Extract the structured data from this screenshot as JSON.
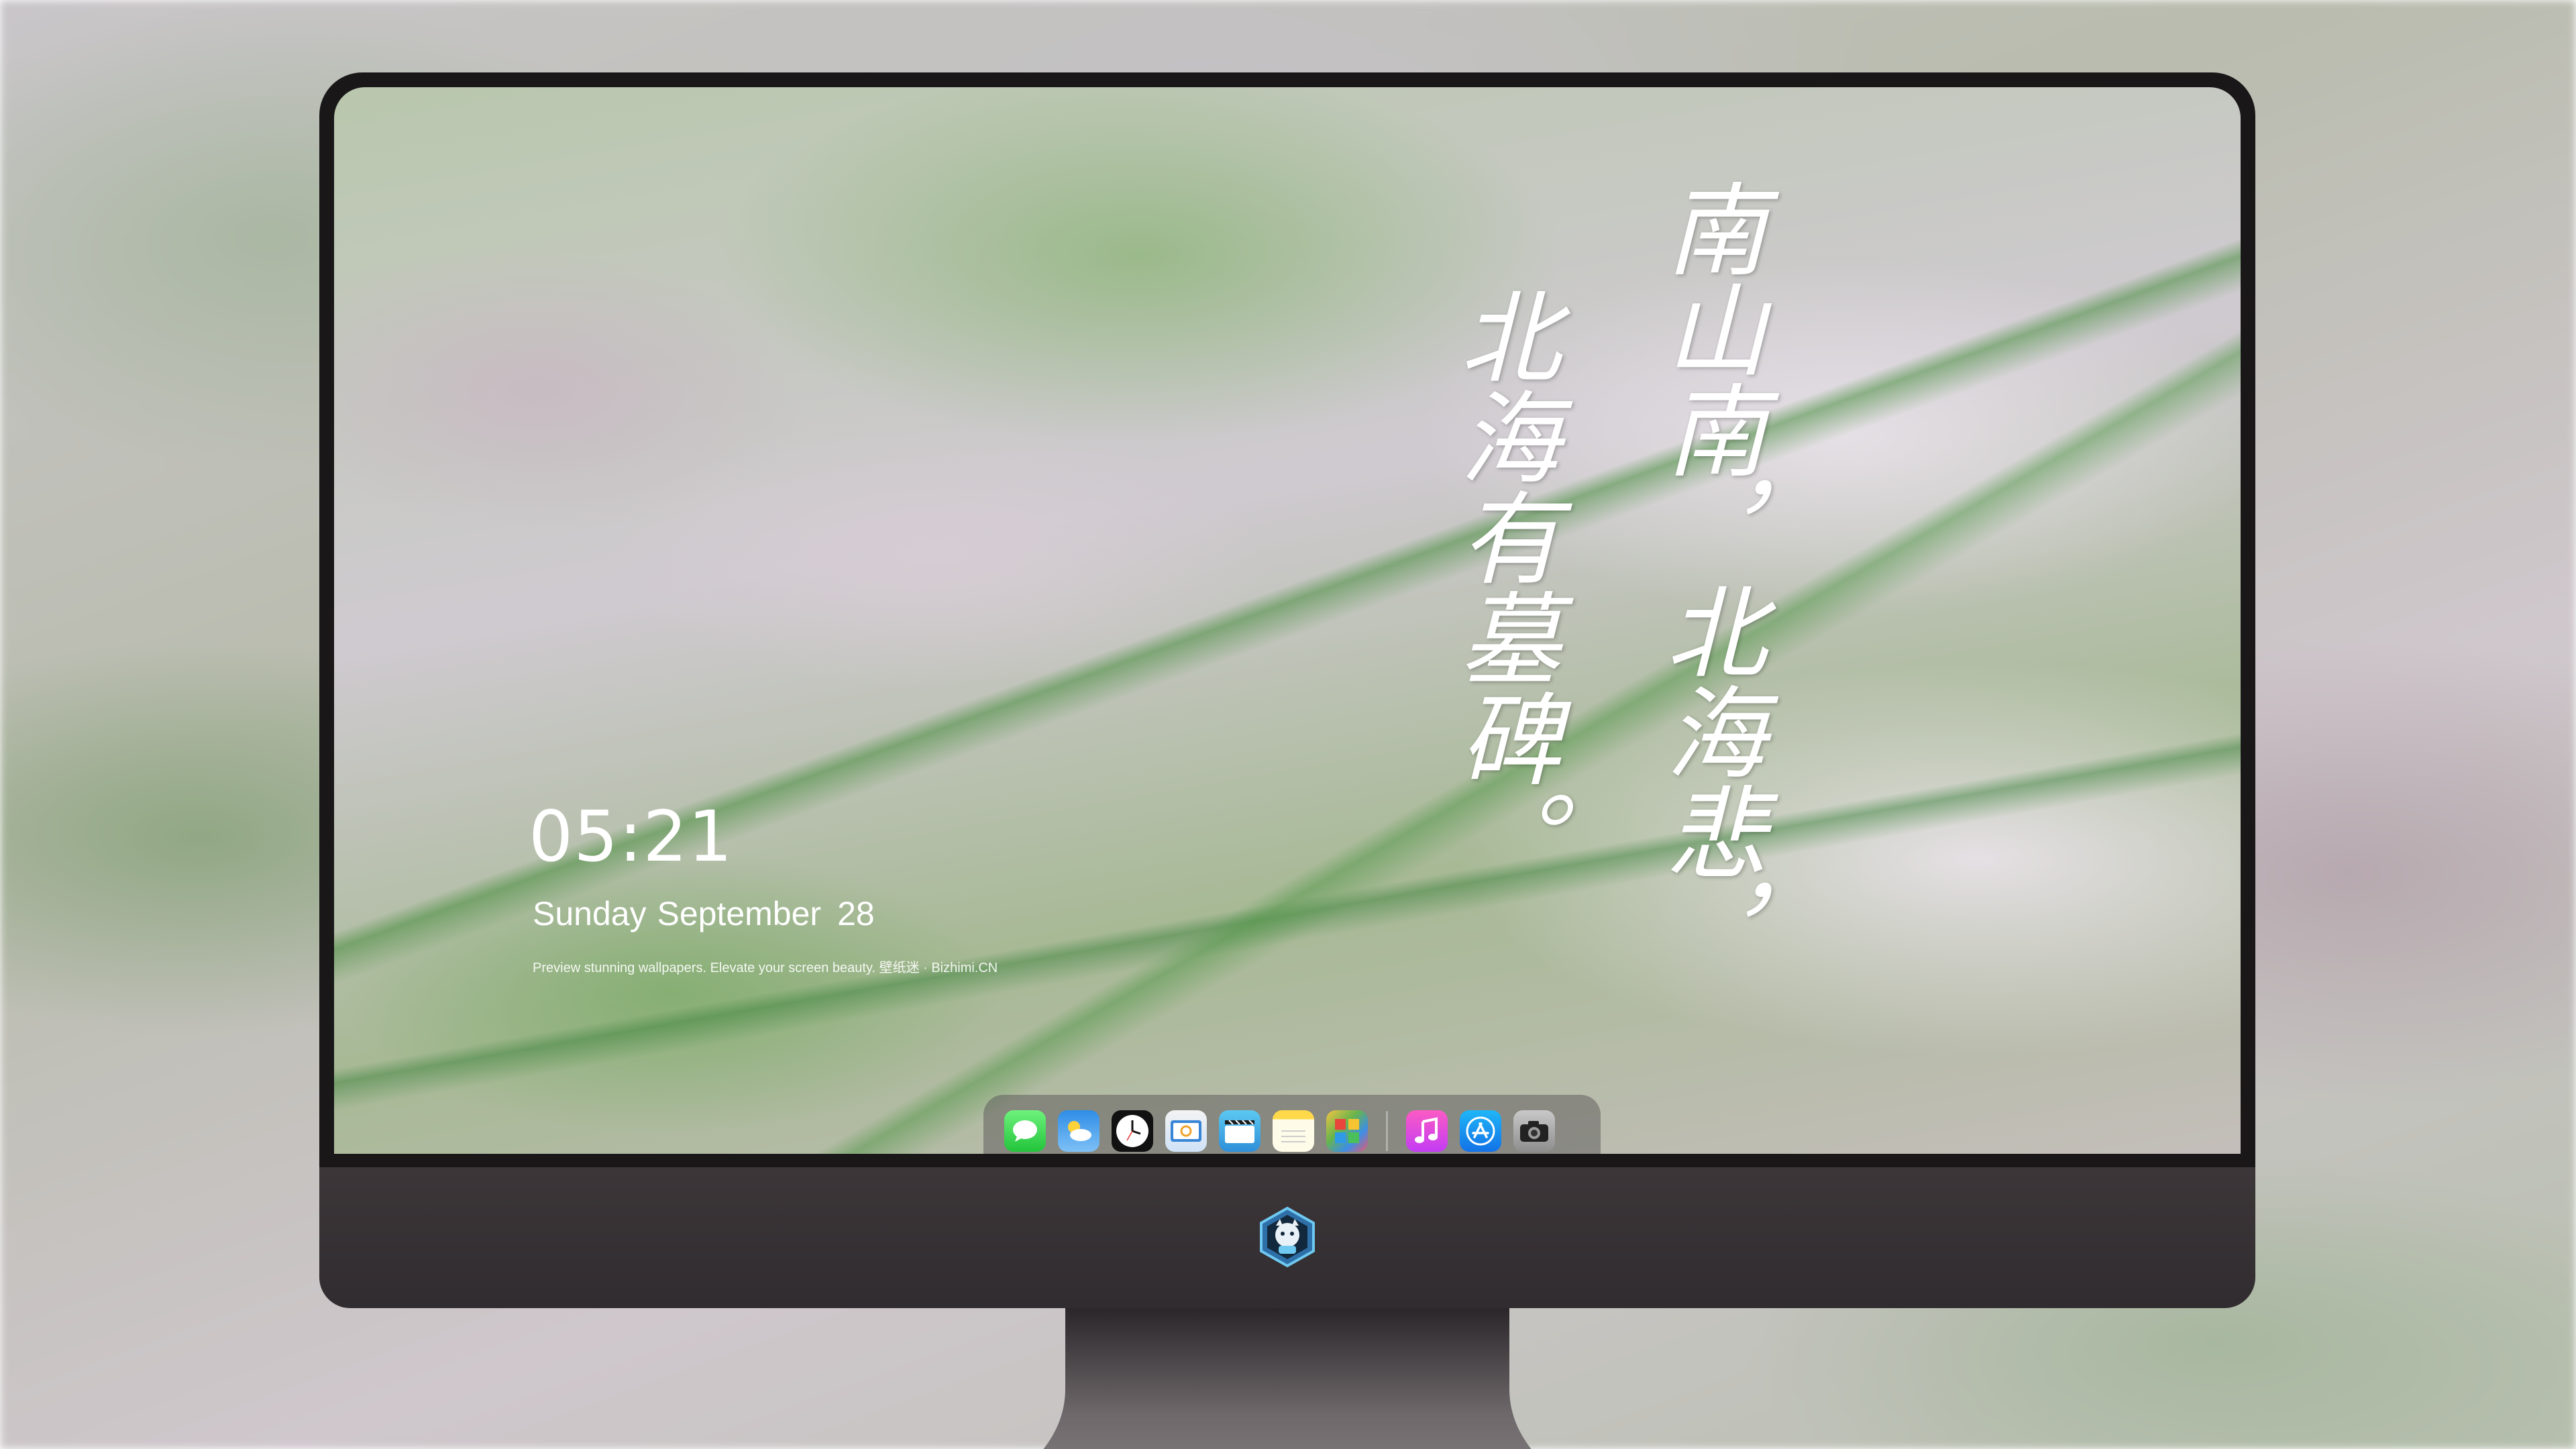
{
  "lock_screen": {
    "time": "05:21",
    "weekday_month": "Sunday September",
    "day": "28",
    "caption": "Preview stunning wallpapers. Elevate your screen beauty. 壁纸迷 · Bizhimi.CN"
  },
  "poem": {
    "column_1": "南山南，北海悲，",
    "column_2": "北海有墓碑。"
  },
  "dock": {
    "apps": [
      {
        "name": "Messages",
        "icon": "messages-icon"
      },
      {
        "name": "Weather",
        "icon": "weather-icon"
      },
      {
        "name": "Clock",
        "icon": "clock-icon"
      },
      {
        "name": "Finder",
        "icon": "finder-icon"
      },
      {
        "name": "Clips",
        "icon": "video-icon"
      },
      {
        "name": "Notes",
        "icon": "notes-icon"
      },
      {
        "name": "Photos",
        "icon": "photos-icon"
      },
      {
        "name": "Music",
        "icon": "music-icon"
      },
      {
        "name": "App Store",
        "icon": "app-store-icon"
      },
      {
        "name": "Camera",
        "icon": "camera-icon"
      }
    ]
  },
  "monitor": {
    "logo_icon": "bizhimi-logo-icon"
  },
  "colors": {
    "bezel": "#1a1719",
    "chin": "#3c3639",
    "text": "#ffffff"
  }
}
